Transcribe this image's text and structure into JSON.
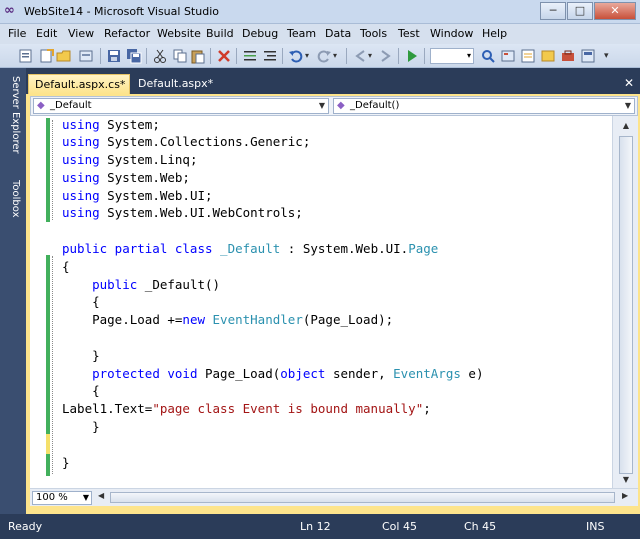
{
  "window": {
    "title": "WebSite14 - Microsoft Visual Studio",
    "min": "0",
    "max": "1",
    "close": "r"
  },
  "menu": [
    "File",
    "Edit",
    "View",
    "Refactor",
    "Website",
    "Build",
    "Debug",
    "Team",
    "Data",
    "Tools",
    "Test",
    "Window",
    "Help"
  ],
  "side_tabs": {
    "server_explorer": "Server Explorer",
    "toolbox": "Toolbox"
  },
  "tabs": [
    {
      "label": "Default.aspx.cs*",
      "active": true
    },
    {
      "label": "Default.aspx*",
      "active": false
    }
  ],
  "navbar": {
    "class_dropdown": "_Default",
    "member_dropdown": "_Default()"
  },
  "code": {
    "l1": {
      "kw": "using",
      "rest": " System;"
    },
    "l2": {
      "kw": "using",
      "rest": " System.Collections.Generic;"
    },
    "l3": {
      "kw": "using",
      "rest": " System.Linq;"
    },
    "l4": {
      "kw": "using",
      "rest": " System.Web;"
    },
    "l5": {
      "kw": "using",
      "rest": " System.Web.UI;"
    },
    "l6": {
      "kw": "using",
      "rest": " System.Web.UI.WebControls;"
    },
    "l8": {
      "kw": "public partial class",
      "sp": " ",
      "cls": "_Default",
      "mid": " : System.Web.UI.",
      "base": "Page"
    },
    "l9": "{",
    "l10": {
      "indent": "    ",
      "kw": "public",
      "rest": " _Default()"
    },
    "l11": "    {",
    "l12": {
      "indent": "    ",
      "pre": "Page.Load +=",
      "kw": "new",
      "sp": " ",
      "ty": "EventHandler",
      "rest": "(Page_Load);"
    },
    "l14": "    }",
    "l15": {
      "indent": "    ",
      "kw": "protected void",
      "mid": " Page_Load(",
      "kw2": "object",
      "mid2": " sender, ",
      "ty": "EventArgs",
      "rest": " e)"
    },
    "l16": "    {",
    "l17": {
      "pre": "Label1.Text=",
      "str": "\"page class Event is bound manually\"",
      "rest": ";"
    },
    "l18": "    }",
    "l20": "}"
  },
  "zoom": "100 %",
  "status": {
    "ready": "Ready",
    "ln": "Ln 12",
    "col": "Col 45",
    "ch": "Ch 45",
    "ins": "INS"
  },
  "colors": {
    "keyword": "#0000ff",
    "type": "#2b91af",
    "string": "#a31515",
    "changed_saved": "#42b05c",
    "changed_unsaved": "#f5e06a"
  }
}
